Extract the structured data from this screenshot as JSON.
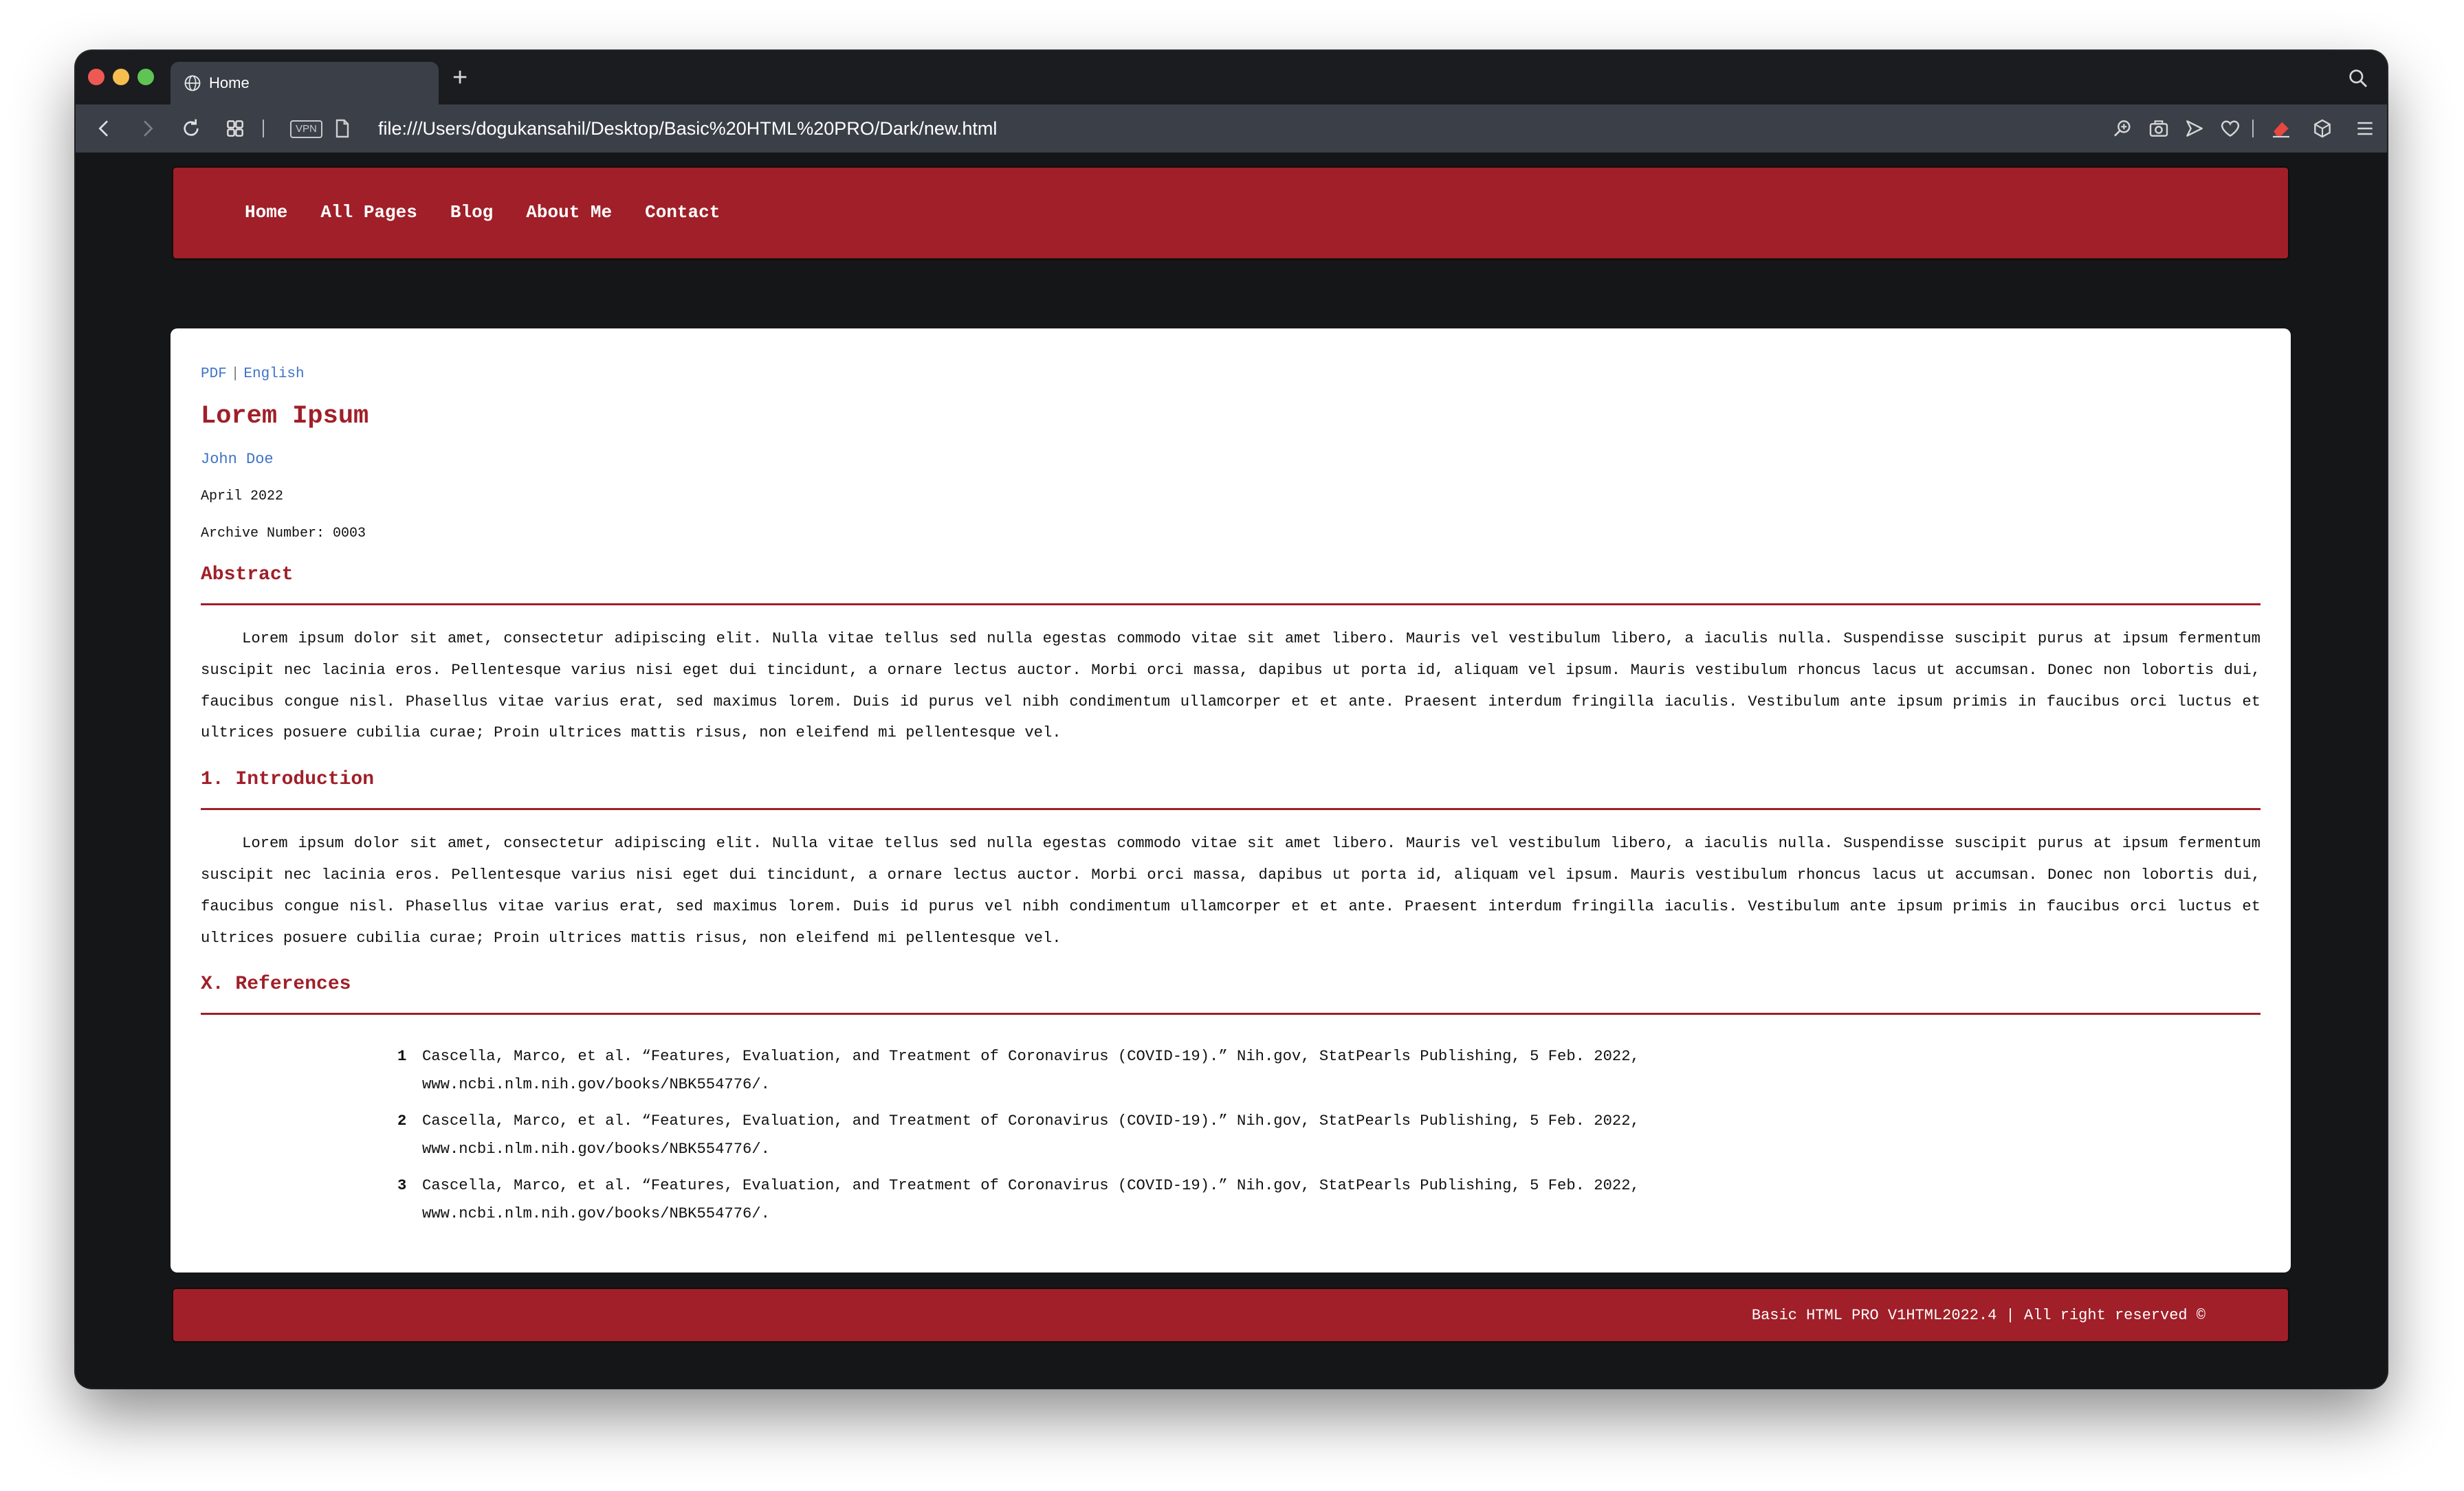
{
  "browser": {
    "tab_title": "Home",
    "new_tab_symbol": "+",
    "url": "file:///Users/dogukansahil/Desktop/Basic%20HTML%20PRO/Dark/new.html",
    "vpn_label": "VPN"
  },
  "site": {
    "nav": [
      "Home",
      "All Pages",
      "Blog",
      "About Me",
      "Contact"
    ],
    "footer": "Basic HTML PRO V1HTML2022.4 | All right reserved ©"
  },
  "article": {
    "links": {
      "pdf": "PDF",
      "separator": "|",
      "language": "English"
    },
    "title": "Lorem Ipsum",
    "author": "John Doe",
    "date": "April 2022",
    "archive": "Archive Number: 0003",
    "abstract_heading": "Abstract",
    "abstract_text": "Lorem ipsum dolor sit amet, consectetur adipiscing elit. Nulla vitae tellus sed nulla egestas commodo vitae sit amet libero. Mauris vel vestibulum libero, a iaculis nulla. Suspendisse suscipit purus at ipsum fermentum suscipit nec lacinia eros. Pellentesque varius nisi eget dui tincidunt, a ornare lectus auctor. Morbi orci massa, dapibus ut porta id, aliquam vel ipsum. Mauris vestibulum rhoncus lacus ut accumsan. Donec non lobortis dui, faucibus congue nisl. Phasellus vitae varius erat, sed maximus lorem. Duis id purus vel nibh condimentum ullamcorper et et ante. Praesent interdum fringilla iaculis. Vestibulum ante ipsum primis in faucibus orci luctus et ultrices posuere cubilia curae; Proin ultrices mattis risus, non eleifend mi pellentesque vel.",
    "intro_heading": "1. Introduction",
    "intro_text": "Lorem ipsum dolor sit amet, consectetur adipiscing elit. Nulla vitae tellus sed nulla egestas commodo vitae sit amet libero. Mauris vel vestibulum libero, a iaculis nulla. Suspendisse suscipit purus at ipsum fermentum suscipit nec lacinia eros. Pellentesque varius nisi eget dui tincidunt, a ornare lectus auctor. Morbi orci massa, dapibus ut porta id, aliquam vel ipsum. Mauris vestibulum rhoncus lacus ut accumsan. Donec non lobortis dui, faucibus congue nisl. Phasellus vitae varius erat, sed maximus lorem. Duis id purus vel nibh condimentum ullamcorper et et ante. Praesent interdum fringilla iaculis. Vestibulum ante ipsum primis in faucibus orci luctus et ultrices posuere cubilia curae; Proin ultrices mattis risus, non eleifend mi pellentesque vel.",
    "references_heading": "X. References",
    "references": [
      {
        "num": "1",
        "text": "Cascella, Marco, et al. “Features, Evaluation, and Treatment of Coronavirus (COVID-19).” Nih.gov, StatPearls Publishing, 5 Feb. 2022, www.ncbi.nlm.nih.gov/books/NBK554776/."
      },
      {
        "num": "2",
        "text": "Cascella, Marco, et al. “Features, Evaluation, and Treatment of Coronavirus (COVID-19).” Nih.gov, StatPearls Publishing, 5 Feb. 2022, www.ncbi.nlm.nih.gov/books/NBK554776/."
      },
      {
        "num": "3",
        "text": "Cascella, Marco, et al. “Features, Evaluation, and Treatment of Coronavirus (COVID-19).” Nih.gov, StatPearls Publishing, 5 Feb. 2022, www.ncbi.nlm.nih.gov/books/NBK554776/."
      }
    ]
  },
  "icons": {
    "tab": "globe-icon",
    "nav_left": [
      "back-icon",
      "forward-icon",
      "reload-icon",
      "tiles-icon"
    ],
    "nav_right": [
      "zoom-icon",
      "camera-icon",
      "send-icon",
      "heart-icon",
      "eraser-icon",
      "cube-icon",
      "menu-icon"
    ]
  },
  "colors": {
    "brand_red": "#a01f28",
    "link_blue": "#3f73c8",
    "page_background": "#151618",
    "chrome_bar": "#3a3f48"
  }
}
